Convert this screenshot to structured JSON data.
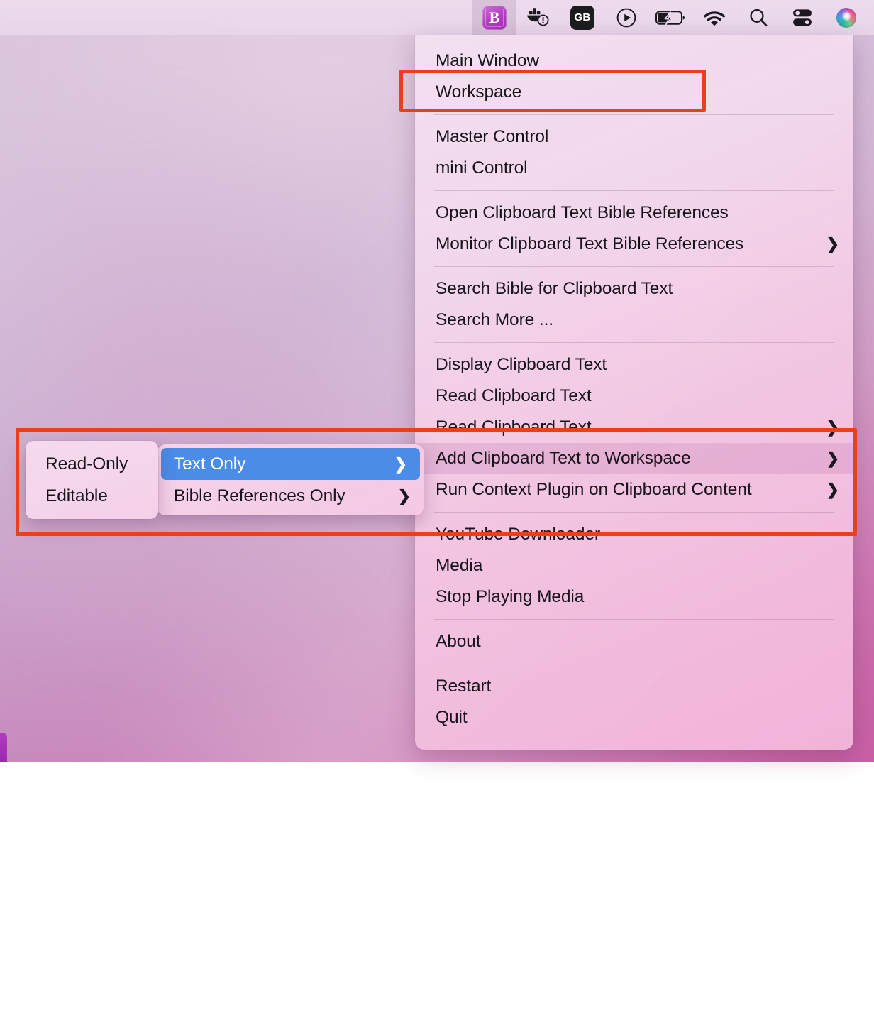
{
  "menubar": {
    "icons": [
      {
        "name": "bible-app-icon",
        "label": "B",
        "type": "app",
        "active": true
      },
      {
        "name": "docker-icon",
        "label": "",
        "type": "docker"
      },
      {
        "name": "gb-icon",
        "label": "GB",
        "type": "badge"
      },
      {
        "name": "play-icon",
        "label": "",
        "type": "play"
      },
      {
        "name": "battery-charging-icon",
        "label": "",
        "type": "battery"
      },
      {
        "name": "wifi-icon",
        "label": "",
        "type": "wifi"
      },
      {
        "name": "spotlight-search-icon",
        "label": "",
        "type": "search"
      },
      {
        "name": "control-center-icon",
        "label": "",
        "type": "control"
      },
      {
        "name": "siri-icon",
        "label": "",
        "type": "siri"
      }
    ]
  },
  "main_menu": {
    "items": [
      {
        "label": "Main Window",
        "submenu": false,
        "highlighted": false
      },
      {
        "label": "Workspace",
        "submenu": false,
        "highlighted": false,
        "annotated": true
      },
      {
        "sep": true
      },
      {
        "label": "Master Control",
        "submenu": false,
        "highlighted": false
      },
      {
        "label": "mini Control",
        "submenu": false,
        "highlighted": false
      },
      {
        "sep": true
      },
      {
        "label": "Open Clipboard Text Bible References",
        "submenu": false,
        "highlighted": false
      },
      {
        "label": "Monitor Clipboard Text Bible References",
        "submenu": true,
        "highlighted": false
      },
      {
        "sep": true
      },
      {
        "label": "Search Bible for Clipboard Text",
        "submenu": false,
        "highlighted": false
      },
      {
        "label": "Search More ...",
        "submenu": false,
        "highlighted": false
      },
      {
        "sep": true
      },
      {
        "label": "Display Clipboard Text",
        "submenu": false,
        "highlighted": false
      },
      {
        "label": "Read Clipboard Text",
        "submenu": false,
        "highlighted": false
      },
      {
        "label": "Read Clipboard Text ...",
        "submenu": true,
        "highlighted": false
      },
      {
        "label": "Add Clipboard Text to Workspace",
        "submenu": true,
        "highlighted": true
      },
      {
        "label": "Run Context Plugin on Clipboard Content",
        "submenu": true,
        "highlighted": false
      },
      {
        "sep": true
      },
      {
        "label": "YouTube Downloader",
        "submenu": false,
        "highlighted": false
      },
      {
        "label": "Media",
        "submenu": false,
        "highlighted": false
      },
      {
        "label": "Stop Playing Media",
        "submenu": false,
        "highlighted": false
      },
      {
        "sep": true
      },
      {
        "label": "About",
        "submenu": false,
        "highlighted": false
      },
      {
        "sep": true
      },
      {
        "label": "Restart",
        "submenu": false,
        "highlighted": false
      },
      {
        "label": "Quit",
        "submenu": false,
        "highlighted": false
      }
    ]
  },
  "submenu_level2": {
    "items": [
      {
        "label": "Text Only",
        "submenu": true,
        "selected": true
      },
      {
        "label": "Bible References Only",
        "submenu": true,
        "selected": false
      }
    ]
  },
  "submenu_level3": {
    "items": [
      {
        "label": "Read-Only",
        "submenu": false,
        "selected": false
      },
      {
        "label": "Editable",
        "submenu": false,
        "selected": false
      }
    ]
  },
  "icons": {
    "chevron_right": "❯"
  },
  "colors": {
    "annotation_red": "#e8401f",
    "selection_blue": "#4a8ce8",
    "menu_text": "#16131a",
    "app_accent": "#b63fc4"
  }
}
